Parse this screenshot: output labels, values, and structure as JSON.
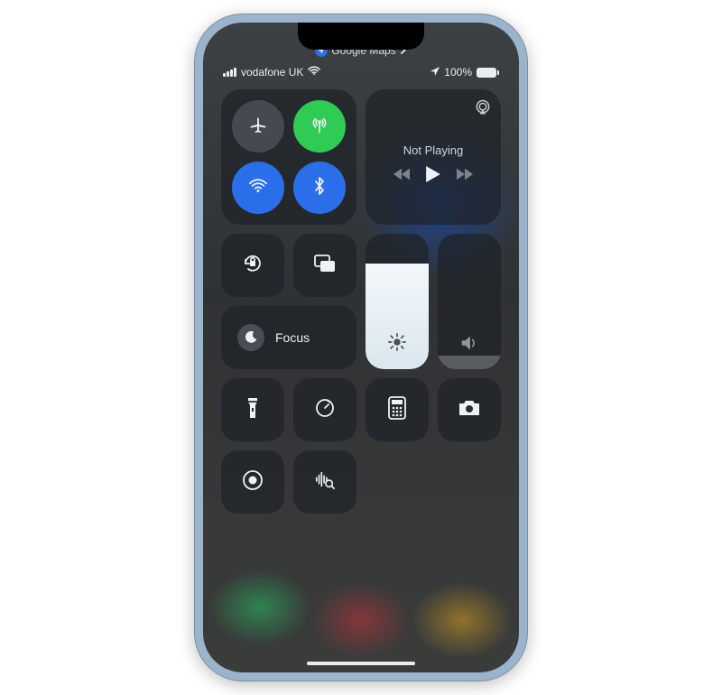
{
  "app_indicator": {
    "label": "Google Maps"
  },
  "status": {
    "carrier": "vodafone UK",
    "battery_pct": "100%"
  },
  "connectivity": {
    "airplane": false,
    "cellular": true,
    "wifi": true,
    "bluetooth": true
  },
  "media": {
    "title": "Not Playing"
  },
  "focus": {
    "label": "Focus"
  },
  "brightness_pct": 78,
  "volume_pct": 10
}
